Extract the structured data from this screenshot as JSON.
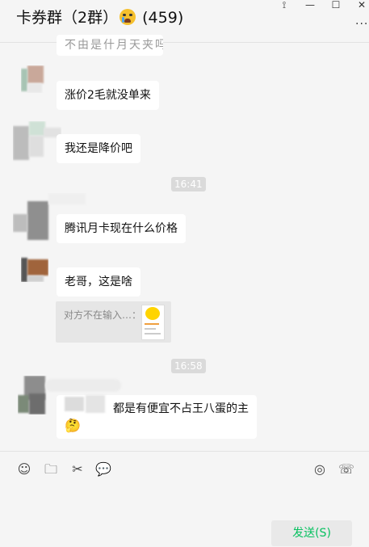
{
  "window": {
    "title_prefix": "卡券群（2群）",
    "member_count": "(459)",
    "more_label": "···",
    "controls": {
      "pin": "⟟",
      "minimize": "—",
      "maximize": "☐",
      "close": "✕"
    }
  },
  "messages": [
    {
      "text": "涨价2毛就没单来"
    },
    {
      "text": "我还是降价吧"
    },
    {
      "time": "16:41"
    },
    {
      "text": "腾讯月卡现在什么价格"
    },
    {
      "text": "老哥，这是啥"
    },
    {
      "quote_label": "对方不在输入…："
    },
    {
      "time": "16:58"
    },
    {
      "text": "都是有便宜不占王八蛋的主",
      "emoji": "🤔"
    }
  ],
  "partial_top_text": "不由是什月天夹吗",
  "toolbar": {
    "emoji_icon": "☺",
    "folder_icon": "🗀",
    "scissors_icon": "✂",
    "chat_icon": "💬",
    "live_icon": "◎",
    "call_icon": "☏"
  },
  "send_label": "发送(S)",
  "colors": {
    "background": "#f5f5f5",
    "bubble": "#ffffff",
    "send_text": "#07c160"
  }
}
